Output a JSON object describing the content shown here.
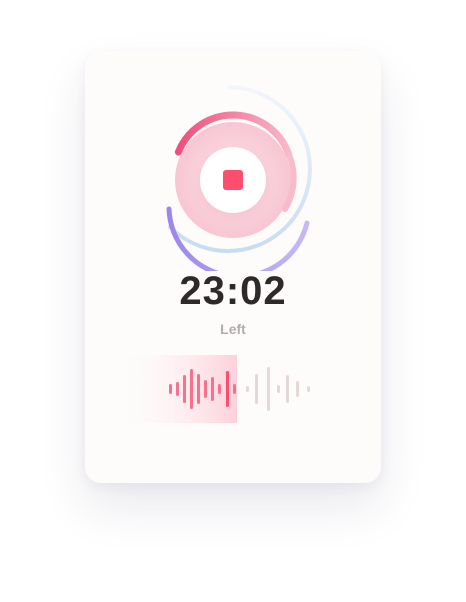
{
  "timer": {
    "remaining": "23:02",
    "label": "Left",
    "progress": 0.72
  },
  "controls": {
    "stop_icon": "stop-icon"
  },
  "waveform": {
    "played_fraction": 0.6
  },
  "colors": {
    "accent": "#ff4d6d",
    "ring_start": "#ef4f7d",
    "ring_end": "#a996f0",
    "outer_ring": "#cfe2f3",
    "played_bar": "#f5728f",
    "unplayed_bar": "#e6d8d8",
    "played_bg": "#fdd5dc"
  }
}
